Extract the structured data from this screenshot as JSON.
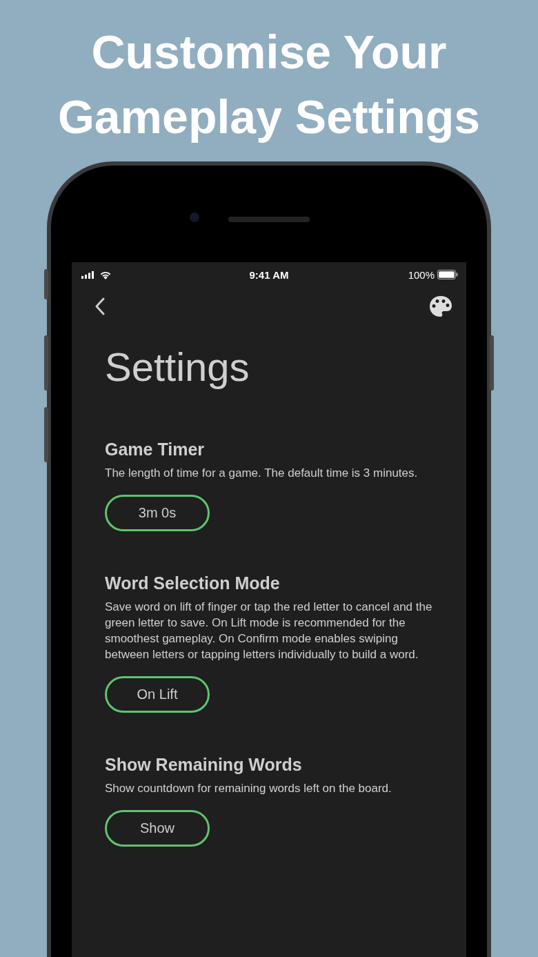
{
  "headline_lines": [
    "Customise Your",
    "Gameplay Settings"
  ],
  "status_bar": {
    "time": "9:41 AM",
    "battery": "100%"
  },
  "page_title": "Settings",
  "settings": [
    {
      "title": "Game Timer",
      "description": "The length of time for a game. The default time is 3 minutes.",
      "value": "3m 0s"
    },
    {
      "title": "Word Selection Mode",
      "description": "Save word on lift of finger or tap the red letter to cancel and the green letter to save. On Lift mode is recommended for the smoothest gameplay. On Confirm mode enables swiping between letters or tapping letters individually to build a word.",
      "value": "On Lift"
    },
    {
      "title": "Show Remaining Words",
      "description": "Show countdown for remaining words left on the board.",
      "value": "Show"
    }
  ]
}
